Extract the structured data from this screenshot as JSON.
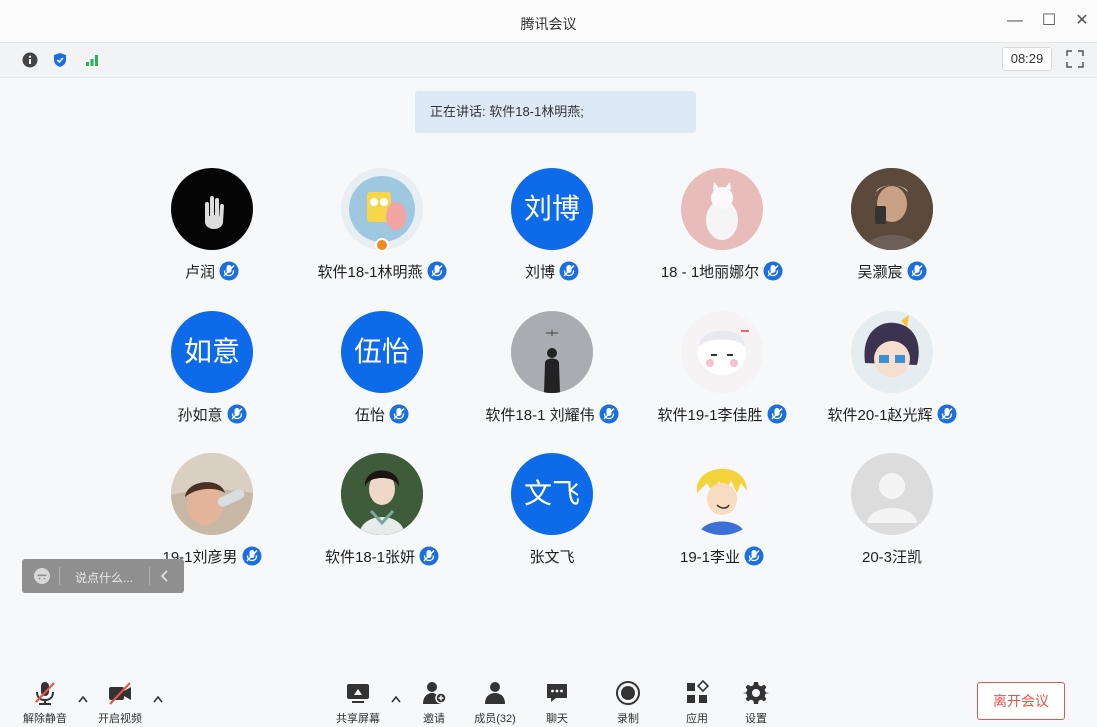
{
  "window": {
    "title": "腾讯会议",
    "minimize": "—",
    "maximize": "☐",
    "close": "✕"
  },
  "infobar": {
    "time": "08:29"
  },
  "speaking": "正在讲话: 软件18-1林明燕;",
  "participants": [
    {
      "name": "卢润",
      "avatar_icon": "hand-photo",
      "mic": true
    },
    {
      "name": "软件18-1林明燕",
      "avatar_icon": "cartoon-sponge-photo",
      "mic": true,
      "host": true
    },
    {
      "name": "刘博",
      "avatar_text": "刘博",
      "mic": true
    },
    {
      "name": "18 - 1地丽娜尔",
      "avatar_icon": "cat-photo",
      "mic": true
    },
    {
      "name": "吴灏宸",
      "avatar_icon": "selfie-photo",
      "mic": true
    },
    {
      "name": "孙如意",
      "avatar_text": "如意",
      "mic": true
    },
    {
      "name": "伍怡",
      "avatar_text": "伍怡",
      "mic": true
    },
    {
      "name": "软件18-1 刘耀伟",
      "avatar_icon": "silhouette-photo",
      "mic": true
    },
    {
      "name": "软件19-1李佳胜",
      "avatar_icon": "anime-sleepy-photo",
      "mic": true
    },
    {
      "name": "软件20-1赵光辉",
      "avatar_icon": "anime-boy-photo",
      "mic": true
    },
    {
      "name": "19-1刘彦男",
      "avatar_icon": "child-photo",
      "mic": true
    },
    {
      "name": "软件18-1张妍",
      "avatar_icon": "portrait-photo",
      "mic": true
    },
    {
      "name": "张文飞",
      "avatar_text": "文飞",
      "mic": false
    },
    {
      "name": "19-1李业",
      "avatar_icon": "anime-blonde-photo",
      "mic": true
    },
    {
      "name": "20-3汪凯",
      "avatar_icon": "default-person",
      "mic": false
    }
  ],
  "chat": {
    "placeholder": "说点什么..."
  },
  "toolbar": {
    "unmute": "解除静音",
    "video": "开启视频",
    "share": "共享屏幕",
    "invite": "邀请",
    "members": "成员(32)",
    "chat": "聊天",
    "record": "录制",
    "apps": "应用",
    "settings": "设置",
    "leave": "离开会议"
  },
  "colors": {
    "accent": "#0d6ae8",
    "danger": "#e2574c"
  }
}
